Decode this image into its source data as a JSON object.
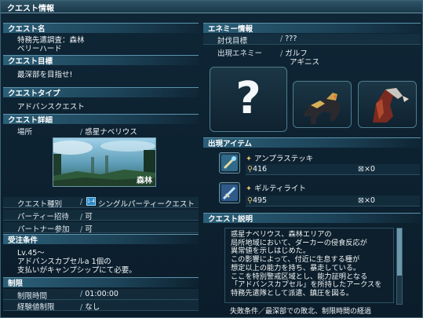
{
  "window": {
    "title": "クエスト情報"
  },
  "left": {
    "quest_name": {
      "header": "クエスト名",
      "line1": "特務先遣調査：森林",
      "line2": "ベリーハード"
    },
    "quest_goal": {
      "header": "クエスト目標",
      "text": "最深部を目指せ!"
    },
    "quest_type": {
      "header": "クエストタイプ",
      "text": "アドバンスクエスト"
    },
    "quest_detail": {
      "header": "クエスト詳細",
      "place_label": "場所",
      "place_value": "惑星ナベリウス",
      "image_caption": "森林",
      "kind_label": "クエスト種別",
      "kind_badge": "1-4",
      "kind_value": "シングルパーティークエスト",
      "party_label": "パーティー招待",
      "party_value": "可",
      "partner_label": "パートナー参加",
      "partner_value": "可"
    },
    "conditions": {
      "header": "受注条件",
      "line1": "Lv.45～",
      "line2": "アドバンスカプセルa 1個の",
      "line3": "支払いがキャンプシップにて必要。"
    },
    "limits": {
      "header": "制限",
      "time_label": "制限時間",
      "time_value": "01:00:00",
      "exp_label": "経験値制限",
      "exp_value": "なし"
    }
  },
  "right": {
    "enemy": {
      "header": "エネミー情報",
      "target_label": "討伐目標",
      "target_value": "???",
      "appear_label": "出現エネミー",
      "appear_line1": "ガルフ",
      "appear_line2": "アギニス"
    },
    "items": {
      "header": "出現アイテム",
      "list": [
        {
          "name": "アンプラステッキ",
          "level": "416",
          "count": "×0",
          "icon": "rod-icon"
        },
        {
          "name": "ギルティライト",
          "level": "495",
          "count": "×0",
          "icon": "sword-icon"
        }
      ]
    },
    "description": {
      "header": "クエスト説明",
      "lines": [
        "惑星ナベリウス、森林エリアの",
        "局所地域において、ダーカーの侵食反応が",
        "異常値を示しはじめた。",
        "この影響によって、付近に生息する種が",
        "想定以上の能力を持ち、暴走している。",
        "ここを特別警戒区域とし、能力証明となる",
        "「アドバンスカプセル」を所持したアークスを",
        "特務先遣隊として派遣、鎮圧を図る。"
      ],
      "fail": "失敗条件／最深部での敗北、制限時間の経過"
    }
  },
  "colors": {
    "accent": "#2b5f78",
    "bg": "#0b1d2b",
    "frame": "#6d97ab"
  }
}
